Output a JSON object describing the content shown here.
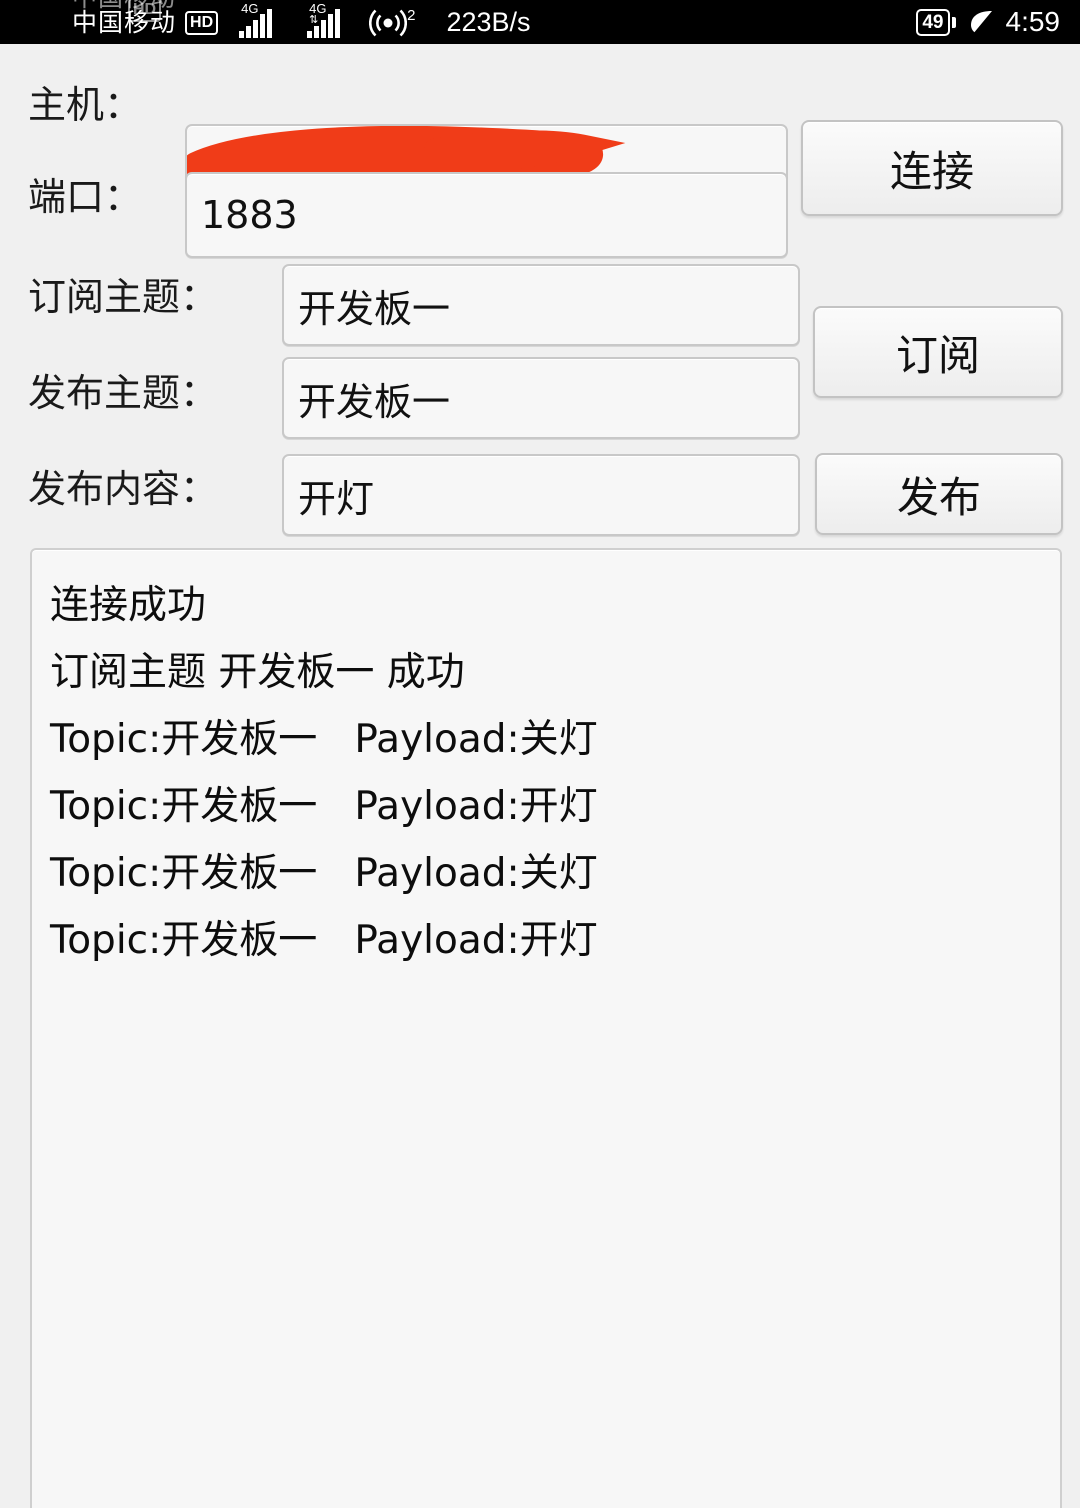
{
  "status_bar": {
    "carrier": "中国移动",
    "hd_badge": "HD",
    "network_type_1": "4G",
    "network_type_2": "4G",
    "hotspot_count": "2",
    "net_speed": "223B/s",
    "battery_level": "49",
    "power_save_icon": "leaf-icon",
    "time": "4:59"
  },
  "form": {
    "host": {
      "label": "主机：",
      "value": "",
      "redacted": true,
      "redaction_color": "#f03c18"
    },
    "port": {
      "label": "端口：",
      "value": "1883"
    },
    "sub_topic": {
      "label": "订阅主题：",
      "value": "开发板一"
    },
    "pub_topic": {
      "label": "发布主题：",
      "value": "开发板一"
    },
    "pub_payload": {
      "label": "发布内容：",
      "value": "开灯"
    }
  },
  "buttons": {
    "connect": "连接",
    "subscribe": "订阅",
    "publish": "发布"
  },
  "log": {
    "lines": [
      "连接成功",
      "订阅主题 开发板一 成功",
      "Topic:开发板一   Payload:关灯",
      "Topic:开发板一   Payload:开灯",
      "Topic:开发板一   Payload:关灯",
      "Topic:开发板一   Payload:开灯"
    ]
  },
  "colors": {
    "background": "#f0f0f0",
    "field_bg": "#f7f7f7",
    "border": "#c8c8c8",
    "text": "#111111",
    "statusbar_bg": "#000000",
    "redaction": "#f03c18"
  }
}
